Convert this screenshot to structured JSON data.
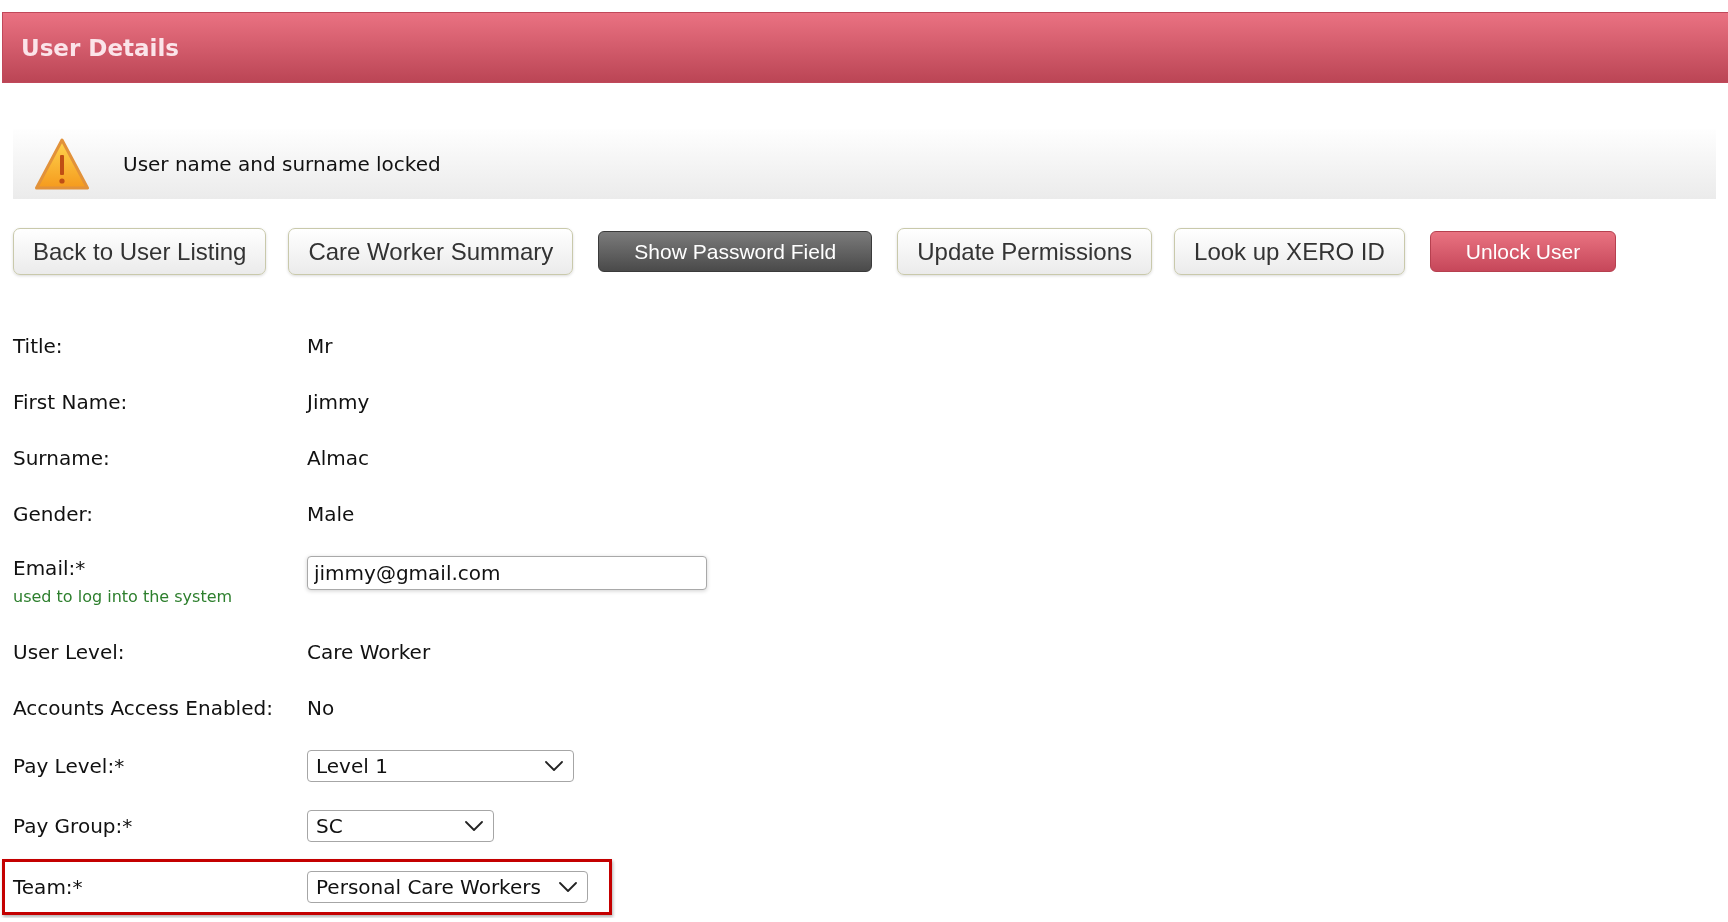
{
  "header": {
    "title": "User Details"
  },
  "notice": {
    "kind": "warning",
    "text": "User name and surname locked"
  },
  "buttons": [
    {
      "label": "Back to User Listing",
      "kind": "default"
    },
    {
      "label": "Care Worker Summary",
      "kind": "default"
    },
    {
      "label": "Show Password Field",
      "kind": "dark"
    },
    {
      "label": "Update Permissions",
      "kind": "default"
    },
    {
      "label": "Look up XERO ID",
      "kind": "default"
    },
    {
      "label": "Unlock User",
      "kind": "danger"
    }
  ],
  "fields": [
    {
      "kind": "text",
      "label": "Title:",
      "value": "Mr",
      "highlighted": false
    },
    {
      "kind": "text",
      "label": "First Name:",
      "value": "Jimmy",
      "highlighted": false
    },
    {
      "kind": "text",
      "label": "Surname:",
      "value": "Almac",
      "highlighted": false
    },
    {
      "kind": "text",
      "label": "Gender:",
      "value": "Male",
      "highlighted": false
    },
    {
      "kind": "input",
      "label": "Email:*",
      "hint": "used to log into the system",
      "value": "jimmy@gmail.com",
      "highlighted": false
    },
    {
      "kind": "text",
      "label": "User Level:",
      "value": "Care Worker",
      "highlighted": false
    },
    {
      "kind": "text",
      "label": "Accounts Access Enabled:",
      "value": "No",
      "highlighted": false
    },
    {
      "kind": "select",
      "label": "Pay Level:*",
      "value": "Level 1",
      "highlighted": false
    },
    {
      "kind": "select",
      "label": "Pay Group:*",
      "value": "SC",
      "highlighted": false
    },
    {
      "kind": "select",
      "label": "Team:*",
      "value": "Personal Care Workers",
      "highlighted": true
    }
  ]
}
